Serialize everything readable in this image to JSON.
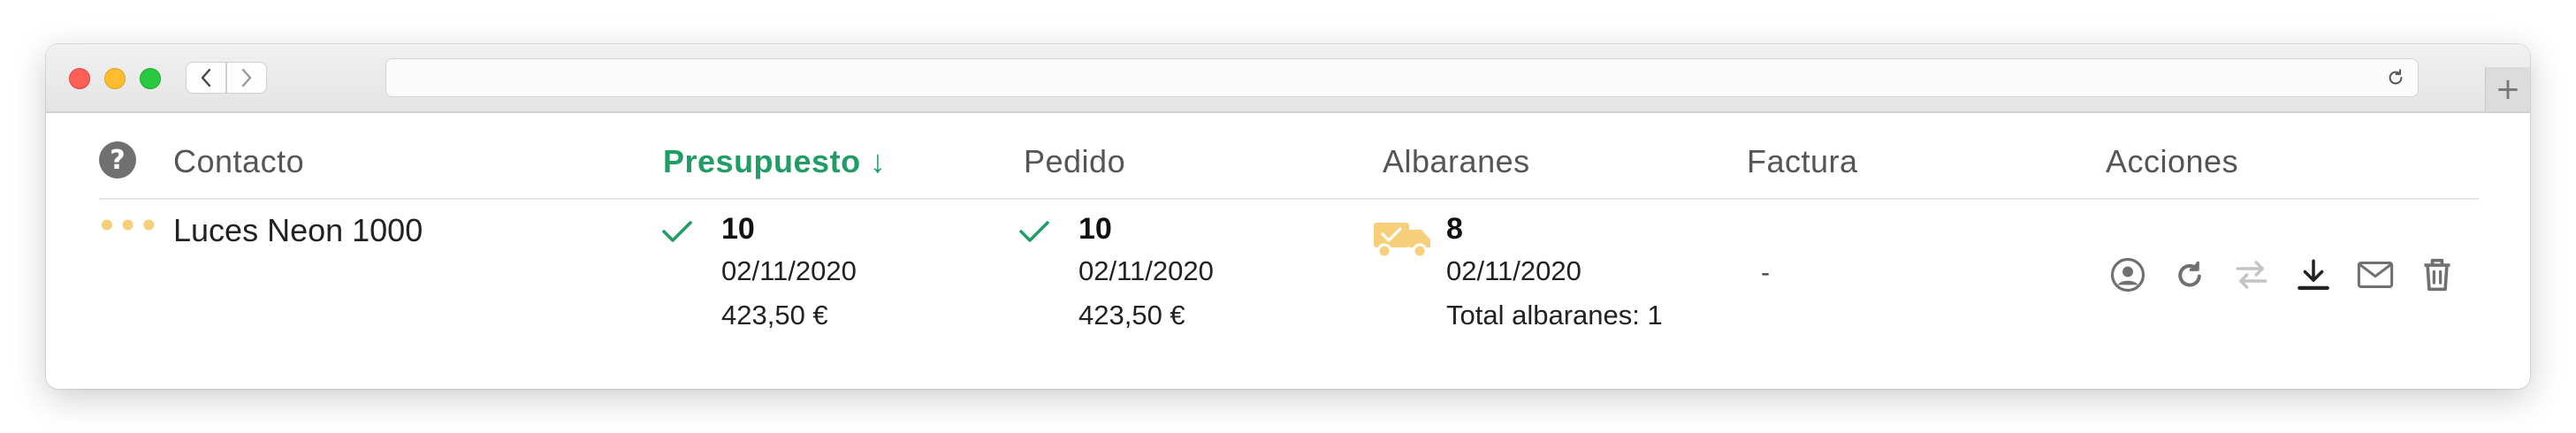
{
  "browser": {
    "new_tab_label": "+"
  },
  "table": {
    "headers": {
      "help": "?",
      "contacto": "Contacto",
      "presupuesto": "Presupuesto ↓",
      "pedido": "Pedido",
      "albaranes": "Albaranes",
      "factura": "Factura",
      "acciones": "Acciones"
    },
    "row": {
      "dots": "•••",
      "contact": "Luces Neon 1000",
      "presupuesto": {
        "number": "10",
        "date": "02/11/2020",
        "amount": "423,50 €"
      },
      "pedido": {
        "number": "10",
        "date": "02/11/2020",
        "amount": "423,50 €"
      },
      "albaranes": {
        "number": "8",
        "date": "02/11/2020",
        "total": "Total albaranes: 1"
      },
      "factura": "-"
    }
  },
  "colors": {
    "accent_green": "#1f9d64",
    "truck_yellow": "#f7cf7a",
    "icon_gray": "#707070"
  },
  "icons": [
    "user-circle-icon",
    "refresh-icon",
    "transfer-icon",
    "download-icon",
    "mail-icon",
    "trash-icon"
  ]
}
